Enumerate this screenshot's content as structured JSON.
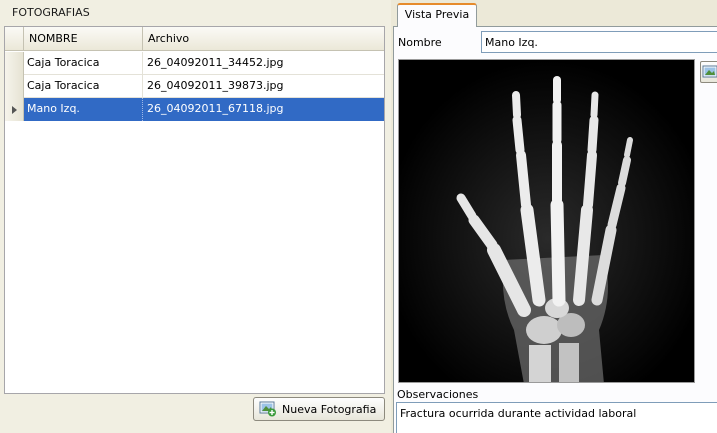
{
  "fotografias": {
    "group_title": "FOTOGRAFIAS",
    "columns": [
      "NOMBRE",
      "Archivo"
    ],
    "rows": [
      {
        "nombre": "Caja Toracica",
        "archivo": "26_04092011_34452.jpg",
        "selected": false
      },
      {
        "nombre": "Caja Toracica",
        "archivo": "26_04092011_39873.jpg",
        "selected": false
      },
      {
        "nombre": "Mano Izq.",
        "archivo": "26_04092011_67118.jpg",
        "selected": true
      }
    ],
    "add_button_label": "Nueva Fotografia",
    "add_button_icon": "image-add-icon"
  },
  "preview": {
    "tab_label": "Vista Previa",
    "nombre_label": "Nombre",
    "nombre_value": "Mano Izq.",
    "observaciones_label": "Observaciones",
    "observaciones_value": "Fractura ocurrida durante actividad laboral",
    "image_icon": "image-icon"
  },
  "colors": {
    "selection": "#316ac5",
    "tab_accent": "#e68b2c",
    "panel_bg": "#ece9d8"
  }
}
